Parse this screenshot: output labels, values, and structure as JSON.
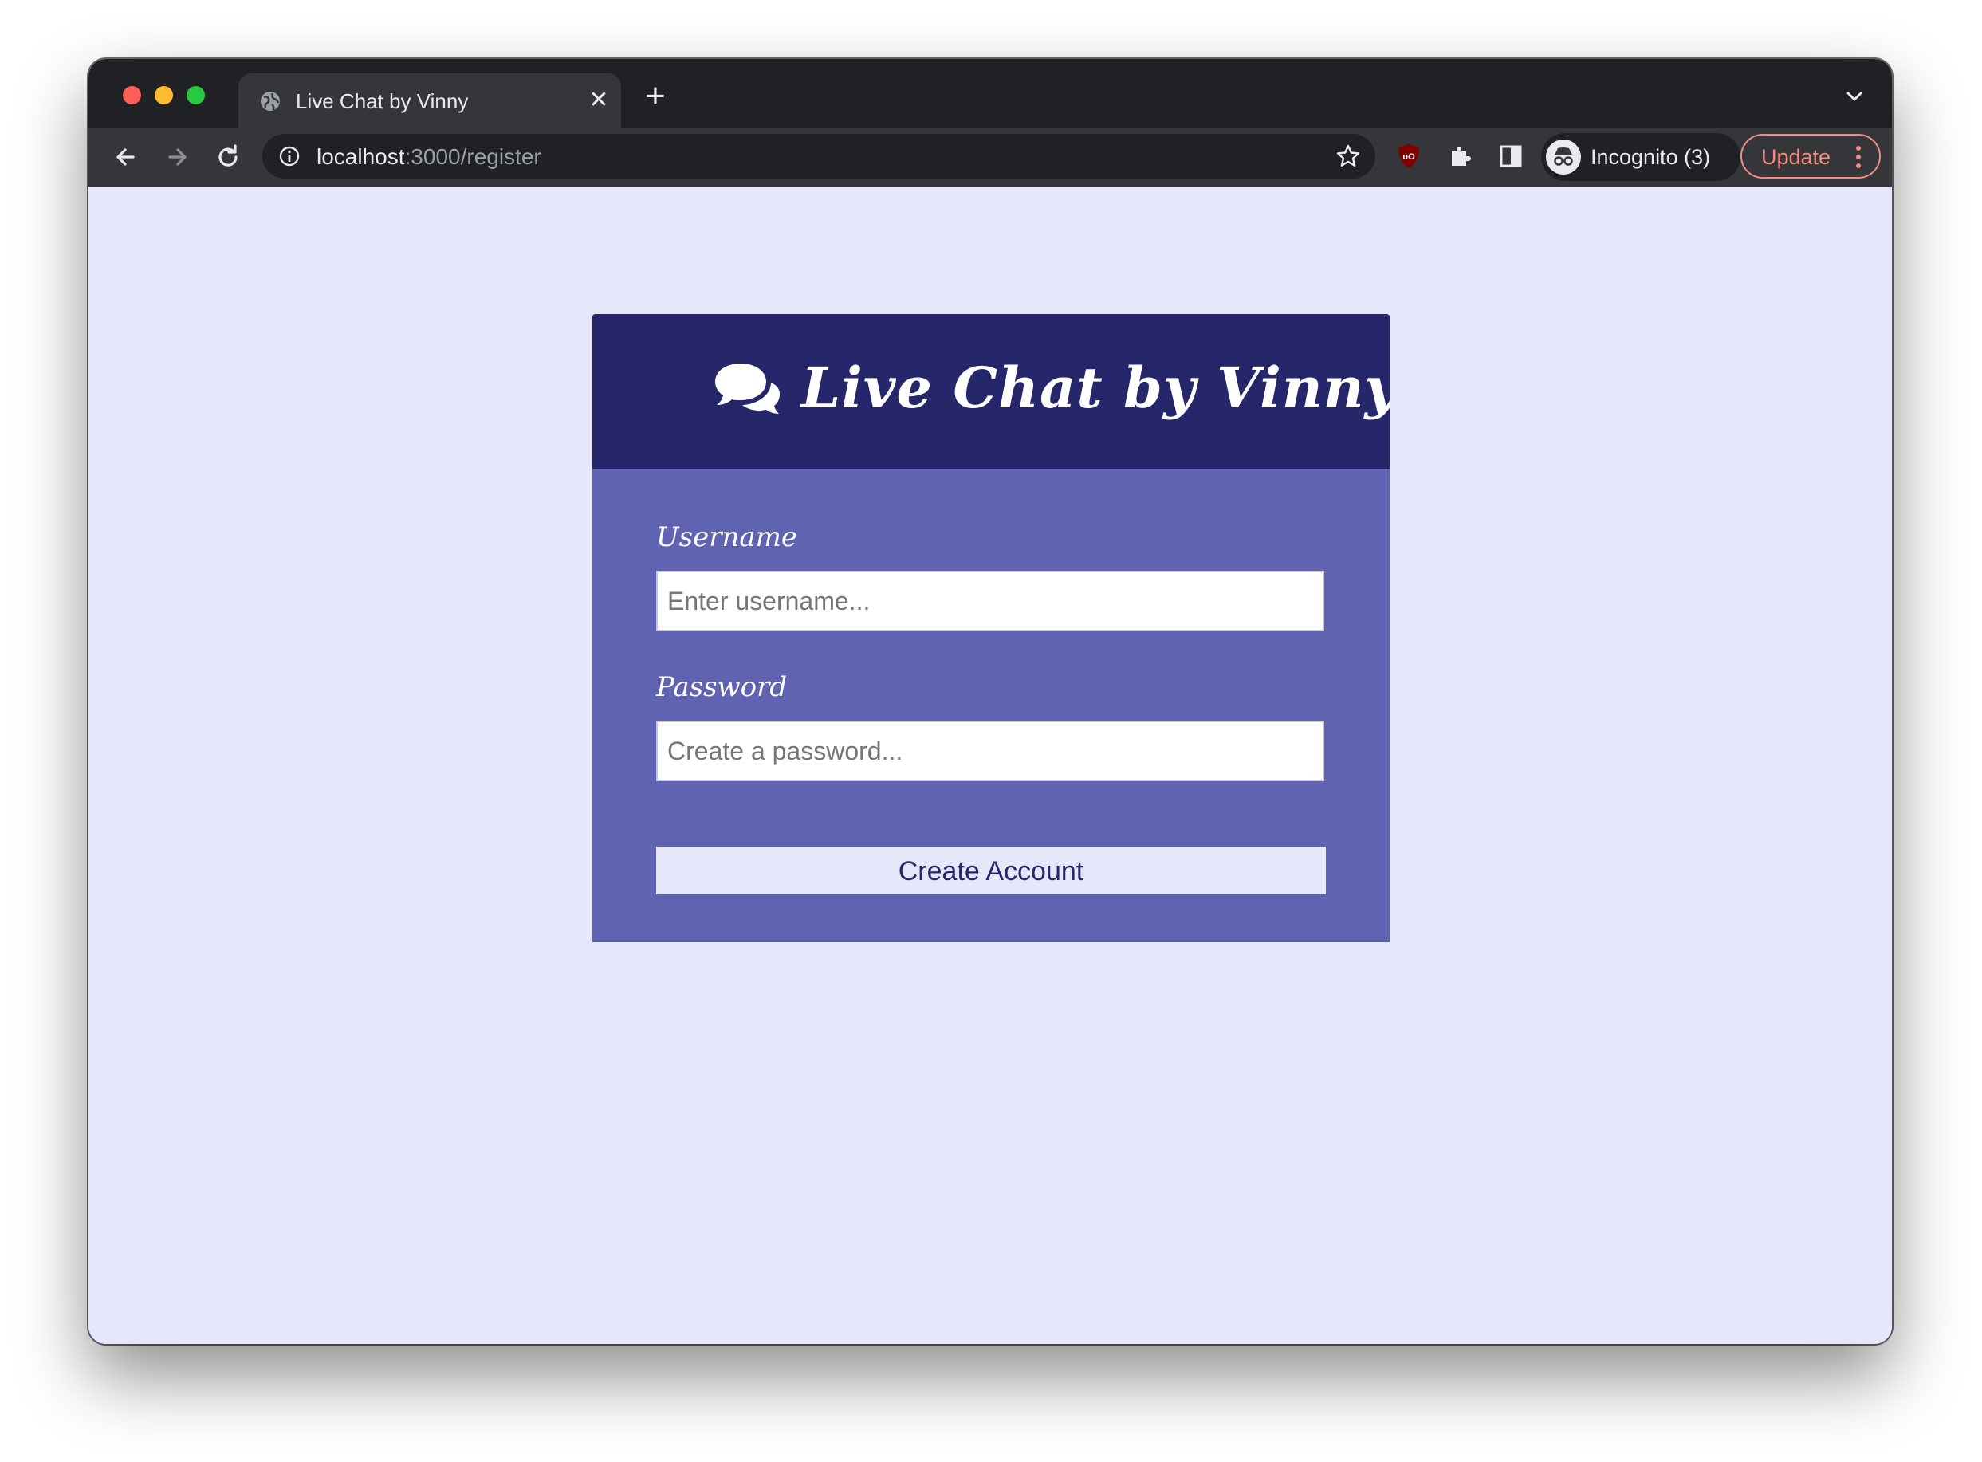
{
  "browser": {
    "tab": {
      "title": "Live Chat by Vinny",
      "favicon": "globe-icon"
    },
    "address_bar": {
      "host": "localhost",
      "path": ":3000/register"
    },
    "profile": {
      "label": "Incognito (3)"
    },
    "update_label": "Update",
    "colors": {
      "frame": "#202124",
      "toolbar": "#35363a",
      "update_accent": "#f28b82"
    }
  },
  "app": {
    "title": "Live Chat by Vinny",
    "header_icon": "comments-icon",
    "form": {
      "username": {
        "label": "Username",
        "placeholder": "Enter username..."
      },
      "password": {
        "label": "Password",
        "placeholder": "Create a password..."
      },
      "submit_label": "Create Account"
    },
    "colors": {
      "page_bg": "#e6e7fb",
      "header_bg": "#26276a",
      "card_bg": "#6063b1",
      "button_text": "#26276a"
    }
  }
}
